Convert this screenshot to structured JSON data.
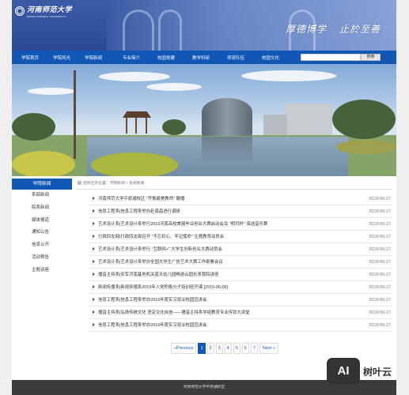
{
  "header": {
    "logo_cn": "河南师范大学",
    "logo_en": "HENAN NORMAL UNIVERSITY",
    "motto_1": "厚德博学",
    "motto_2": "止於至善"
  },
  "nav": {
    "items": [
      "学院首页",
      "学院风光",
      "学院新闻",
      "专业简介",
      "校园党建",
      "教学科研",
      "师资队伍",
      "校园文化"
    ],
    "search_placeholder": "",
    "search_button": "搜索"
  },
  "sidebar": {
    "title": "学院新闻",
    "items": [
      "系部新闻",
      "院系新闻",
      "媒体报道",
      "通知公告",
      "信息公开",
      "活动预告",
      "主题讲座"
    ]
  },
  "breadcrumb": "您所在的位置：学院新闻 > 系部新闻",
  "news": [
    {
      "title": "河南师范大学平原湖校区 \"齐鲁最美教师\" 展播",
      "date": "2019-06-27"
    },
    {
      "title": "信息工程系|信息工程系举办赴南昌进行调研",
      "date": "2019-06-27"
    },
    {
      "title": "艺术设计系|艺术设计系举行2019河南高校首届毕业创业大赛启动会及 \"明月杯\" 海选音乐赛",
      "date": "2019-06-27"
    },
    {
      "title": "行政四支部|行政四支部召开 \"不忘初心、牢记使命\" 主题教育动员会",
      "date": "2019-06-27"
    },
    {
      "title": "艺术设计系|艺术设计系举行 \"互联网+\" 大学生创新创业大赛动员会",
      "date": "2019-06-27"
    },
    {
      "title": "艺术设计系|艺术设计系举办全国大学生广告艺术大赛工作部署会议",
      "date": "2019-06-27"
    },
    {
      "title": "播音主持系|安军济南基地机关蓝天幼儿园畅游云园长来我院讲座",
      "date": "2019-06-27"
    },
    {
      "title": "新闻传播系|新闻传播系2019年入党积极分子培训班开课 [2019-06-06]",
      "date": "2019-06-27"
    },
    {
      "title": "信息工程系|信息工程系举办2019年度实习就业校园宣讲会",
      "date": "2019-06-27"
    },
    {
      "title": "播音主持系|弘扬传统文化 坚定文化自信——播音主持系学组教育专业传钦大讲堂",
      "date": "2019-06-27"
    },
    {
      "title": "信息工程系|信息工程系举办2019年度实习就业校园宣讲会",
      "date": "2019-06-27"
    }
  ],
  "pagination": {
    "prev": "«Previous",
    "pages": [
      "1",
      "2",
      "3",
      "4",
      "5",
      "6",
      "7"
    ],
    "next": "Next »",
    "current": "1"
  },
  "footer": "河南师范大学平原湖校区",
  "watermark": {
    "box": "AI",
    "text": "树叶云"
  },
  "colors": {
    "primary": "#1057b6",
    "header": "#2b4a95",
    "footer": "#3c3c3c"
  }
}
